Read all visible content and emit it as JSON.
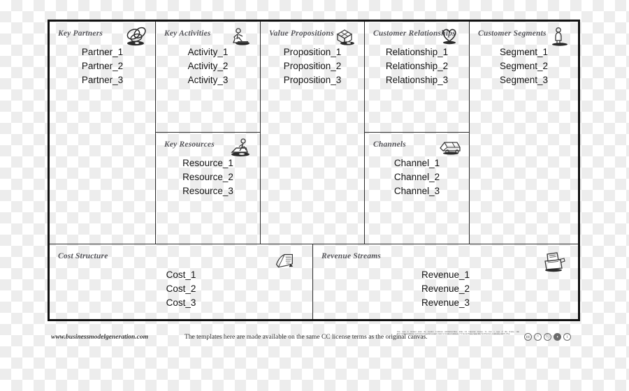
{
  "canvas": {
    "blocks": [
      {
        "key": "key_partners",
        "title": "Key Partners",
        "icon": "chain-links-icon",
        "entries": [
          "Partner_1",
          "Partner_2",
          "Partner_3"
        ]
      },
      {
        "key": "key_activities",
        "title": "Key Activities",
        "icon": "worker-figure-icon",
        "entries": [
          "Activity_1",
          "Activity_2",
          "Activity_3"
        ]
      },
      {
        "key": "key_resources",
        "title": "Key Resources",
        "icon": "quarry-worker-icon",
        "entries": [
          "Resource_1",
          "Resource_2",
          "Resource_3"
        ]
      },
      {
        "key": "value_propositions",
        "title": "Value Propositions",
        "icon": "gift-package-icon",
        "entries": [
          "Proposition_1",
          "Proposition_2",
          "Proposition_3"
        ]
      },
      {
        "key": "customer_relationships",
        "title": "Customer Relationships",
        "icon": "heart-icon",
        "entries": [
          "Relationship_1",
          "Relationship_2",
          "Relationship_3"
        ]
      },
      {
        "key": "channels",
        "title": "Channels",
        "icon": "delivery-truck-icon",
        "entries": [
          "Channel_1",
          "Channel_2",
          "Channel_3"
        ]
      },
      {
        "key": "customer_segments",
        "title": "Customer Segments",
        "icon": "person-standing-icon",
        "entries": [
          "Segment_1",
          "Segment_2",
          "Segment_3"
        ]
      },
      {
        "key": "cost_structure",
        "title": "Cost Structure",
        "icon": "price-tag-icon",
        "entries": [
          "Cost_1",
          "Cost_2",
          "Cost_3"
        ]
      },
      {
        "key": "revenue_streams",
        "title": "Revenue Streams",
        "icon": "cash-register-icon",
        "entries": [
          "Revenue_1",
          "Revenue_2",
          "Revenue_3"
        ]
      }
    ]
  },
  "footer": {
    "url": "www.businessmodelgeneration.com",
    "note": "The templates here are made available on the same CC license terms as the original canvas.",
    "fineprint": "This work is licensed under the Creative Commons Attribution-Share Alike 3.0 Unported License. To view a copy of this license, visit http://creativecommons.org/licenses/by-sa/3.0/ or send a letter to Creative Commons, 171 Second Street, Suite 300, San Francisco, California, 94105, USA.",
    "badges": [
      {
        "name": "cc-icon",
        "glyph": "cc"
      },
      {
        "name": "cc-by-icon",
        "glyph": "ᵇ"
      },
      {
        "name": "cc-nd-icon",
        "glyph": "Ⓒ"
      },
      {
        "name": "cc-sa-icon",
        "glyph": "◖"
      },
      {
        "name": "cc-info-icon",
        "glyph": "i"
      }
    ]
  },
  "colors": {
    "frame": "#111111",
    "divider": "#2b2b2b",
    "title_text": "#55555a",
    "entry_text": "#141414"
  }
}
